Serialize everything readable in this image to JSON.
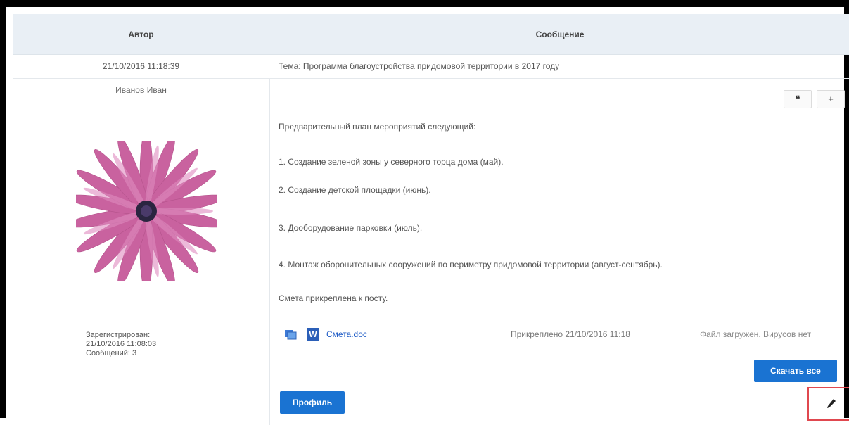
{
  "header": {
    "author_label": "Автор",
    "message_label": "Сообщение"
  },
  "topic_row": {
    "date": "21/10/2016 11:18:39",
    "topic": "Тема: Программа благоустройства придомовой территории в 2017 году"
  },
  "post": {
    "author_name": "Иванов Иван",
    "avatar_icon": "flower-avatar-icon",
    "registered_label": "Зарегистрирован:",
    "registered_date": "21/10/2016 11:08:03",
    "messages_count": "Сообщений: 3",
    "quote_label": "❝",
    "plus_label": "+",
    "lines": [
      "Предварительный план мероприятий следующий:",
      "1. Создание зеленой зоны у северного торца дома (май).",
      "2. Создание детской площадки (июнь).",
      "3. Дооборудование парковки (июль).",
      "4. Монтаж оборонительных сооружений по периметру придомовой территории (август-сентябрь).",
      "Смета прикреплена к посту."
    ],
    "attachment": {
      "preview_icon": "preview-icon",
      "word_icon": "word-file-icon",
      "word_letter": "W",
      "file_name": "Смета.doc",
      "attached_text": "Прикреплено 21/10/2016 11:18",
      "status_text": "Файл загружен. Вирусов нет"
    },
    "download_all_label": "Скачать все",
    "profile_label": "Профиль",
    "edit_icon": "pencil-icon"
  }
}
